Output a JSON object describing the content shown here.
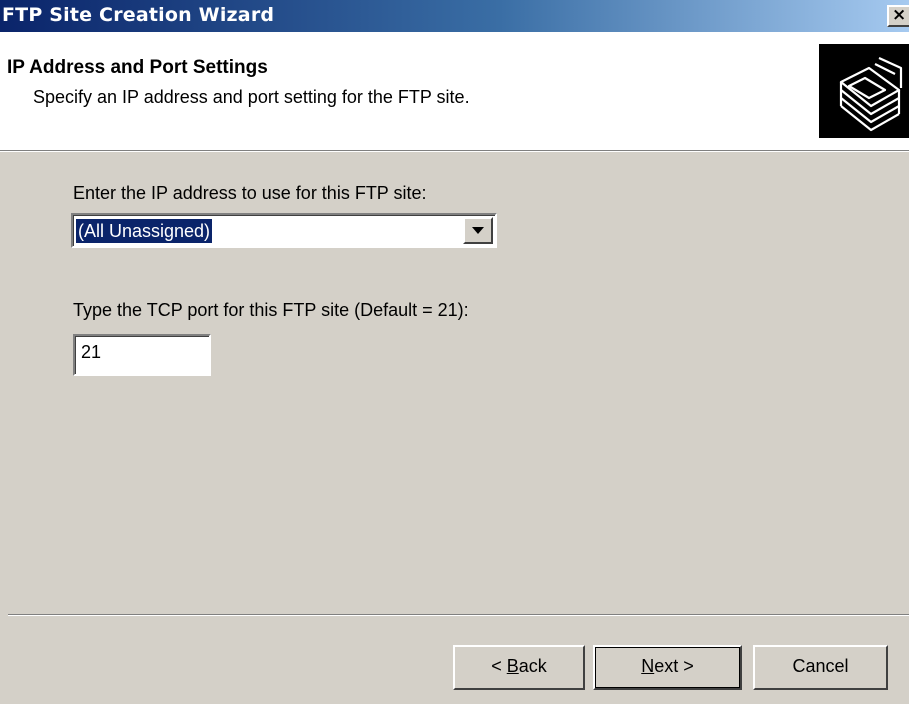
{
  "window": {
    "title": "FTP Site Creation Wizard",
    "close_glyph": "×"
  },
  "header": {
    "title": "IP Address and Port Settings",
    "subtitle": "Specify an IP address and port setting for the FTP site.",
    "icon": "ftp-folder-icon"
  },
  "ip": {
    "label": "Enter the IP address to use for this FTP site:",
    "selected": "(All Unassigned)"
  },
  "port": {
    "label": "Type the TCP port for this FTP site (Default = 21):",
    "value": "21"
  },
  "buttons": {
    "back_prefix": "< ",
    "back_key": "B",
    "back_rest": "ack",
    "next_key": "N",
    "next_rest": "ext >",
    "cancel": "Cancel"
  },
  "colors": {
    "titlebar_start": "#0a246a",
    "titlebar_end": "#a6caf0",
    "dialog_bg": "#d4d0c8",
    "selection": "#0a246a"
  }
}
